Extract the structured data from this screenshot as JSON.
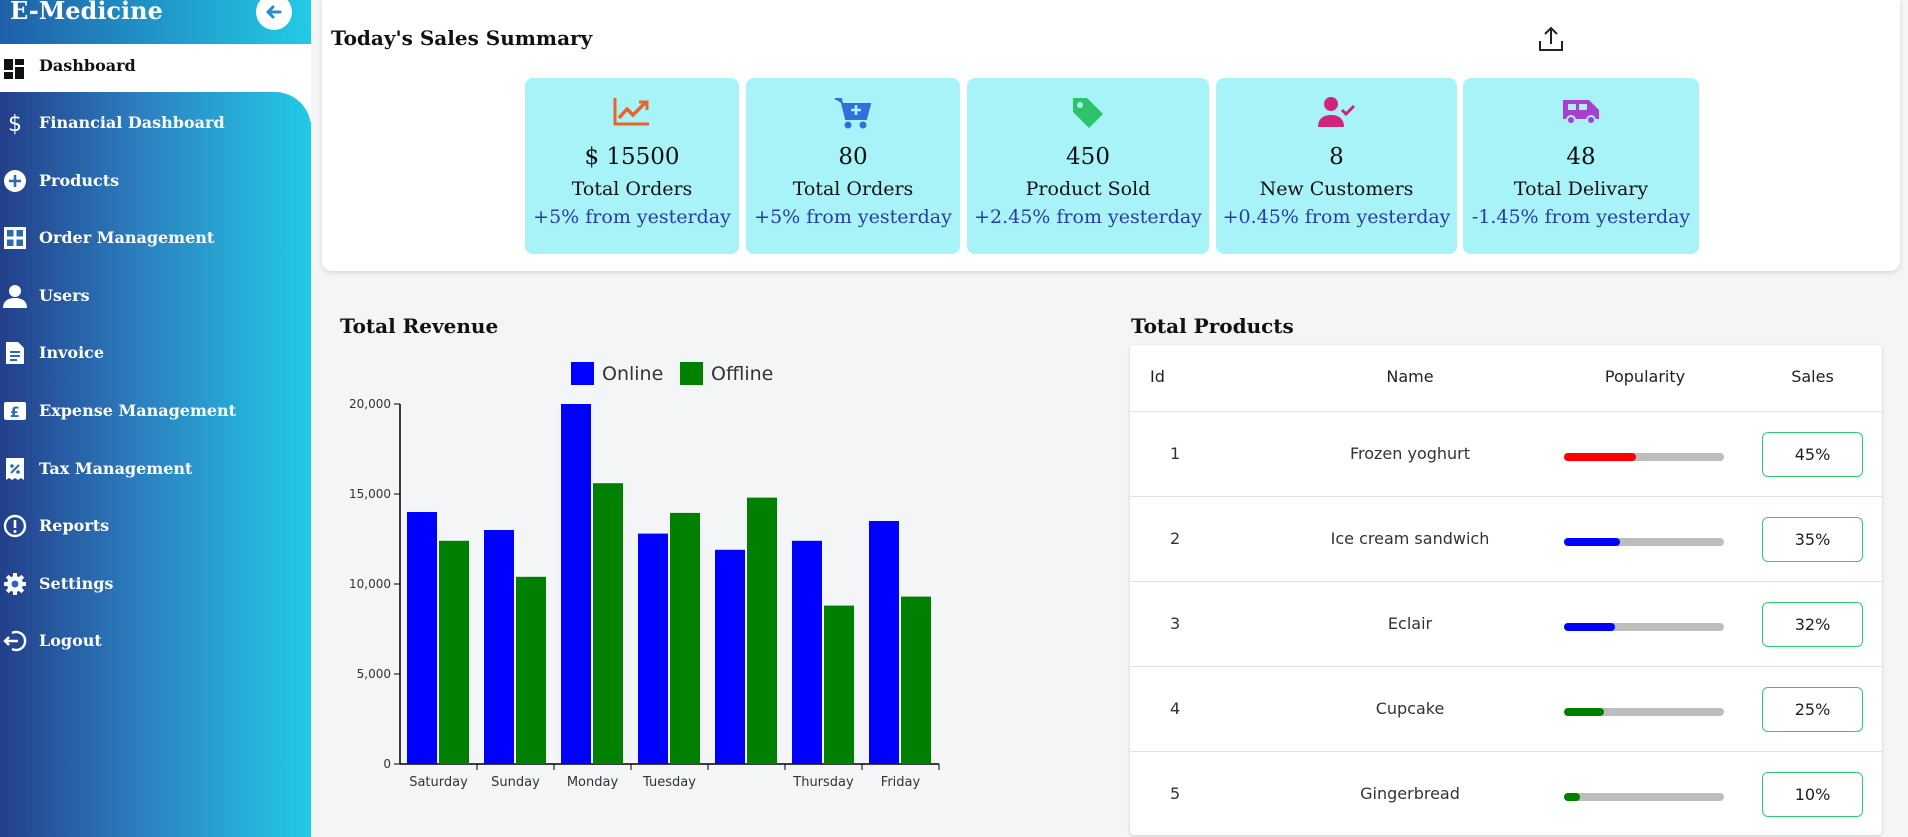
{
  "sidebar": {
    "brand": "E-Medicine",
    "active_item": "Dashboard",
    "items": [
      {
        "label": "Financial Dashboard",
        "icon": "dollar-icon"
      },
      {
        "label": "Products",
        "icon": "add-circle-icon"
      },
      {
        "label": "Order Management",
        "icon": "grid-icon"
      },
      {
        "label": "Users",
        "icon": "user-icon"
      },
      {
        "label": "Invoice",
        "icon": "invoice-icon"
      },
      {
        "label": "Expense Management",
        "icon": "pound-icon"
      },
      {
        "label": "Tax Management",
        "icon": "tax-icon"
      },
      {
        "label": "Reports",
        "icon": "alert-icon"
      },
      {
        "label": "Settings",
        "icon": "gear-icon"
      },
      {
        "label": "Logout",
        "icon": "logout-icon"
      }
    ]
  },
  "summary": {
    "title": "Today's Sales Summary",
    "stats": [
      {
        "value": "$ 15500",
        "label": "Total Orders",
        "change": "+5% from yesterday",
        "icon": "trending-up-icon",
        "icon_color": "#e8652a"
      },
      {
        "value": "80",
        "label": "Total Orders",
        "change": "+5% from yesterday",
        "icon": "cart-icon",
        "icon_color": "#2f6fde"
      },
      {
        "value": "450",
        "label": "Product Sold",
        "change": "+2.45% from yesterday",
        "icon": "tag-icon",
        "icon_color": "#2ec36b"
      },
      {
        "value": "8",
        "label": "New Customers",
        "change": "+0.45% from yesterday",
        "icon": "user-check-icon",
        "icon_color": "#d0267a"
      },
      {
        "value": "48",
        "label": "Total Delivary",
        "change": "-1.45% from yesterday",
        "icon": "van-icon",
        "icon_color": "#a93fd0"
      }
    ]
  },
  "revenue": {
    "title": "Total Revenue"
  },
  "chart_data": {
    "type": "bar",
    "categories": [
      "Saturday",
      "Sunday",
      "Monday",
      "Tuesday",
      "",
      "Thursday",
      "Friday"
    ],
    "series": [
      {
        "name": "Online",
        "color": "#0000ff",
        "values": [
          14000,
          13000,
          20000,
          12800,
          11900,
          12400,
          13500
        ]
      },
      {
        "name": "Offline",
        "color": "#008000",
        "values": [
          12400,
          10400,
          15600,
          13950,
          14800,
          8800,
          9300
        ]
      }
    ],
    "yticks": [
      "0",
      "5,000",
      "10,000",
      "15,000",
      "20,000"
    ],
    "ylim": [
      0,
      20000
    ],
    "legend": "top-center",
    "grid": false
  },
  "products": {
    "title": "Total Products",
    "columns": [
      "Id",
      "Name",
      "Popularity",
      "Sales"
    ],
    "rows": [
      {
        "id": "1",
        "name": "Frozen yoghurt",
        "popularity": 0.45,
        "color": "#ff0000",
        "sales": "45%"
      },
      {
        "id": "2",
        "name": "Ice cream sandwich",
        "popularity": 0.35,
        "color": "#0000ff",
        "sales": "35%"
      },
      {
        "id": "3",
        "name": "Eclair",
        "popularity": 0.32,
        "color": "#0000ff",
        "sales": "32%"
      },
      {
        "id": "4",
        "name": "Cupcake",
        "popularity": 0.25,
        "color": "#008000",
        "sales": "25%"
      },
      {
        "id": "5",
        "name": "Gingerbread",
        "popularity": 0.1,
        "color": "#008000",
        "sales": "10%"
      }
    ]
  }
}
